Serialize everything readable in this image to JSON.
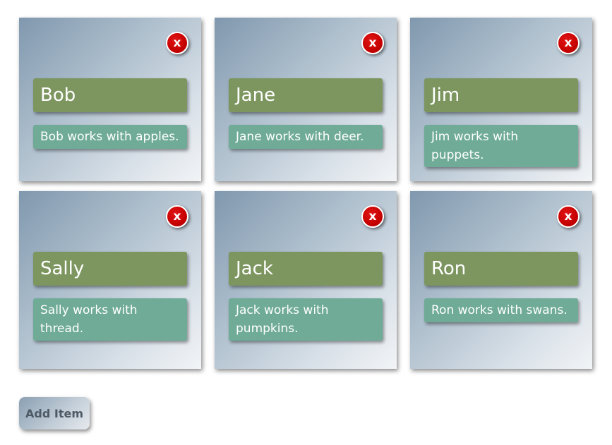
{
  "cards": [
    {
      "name": "Bob",
      "description": "Bob works with apples.",
      "close_label": "x"
    },
    {
      "name": "Jane",
      "description": "Jane works with deer.",
      "close_label": "x"
    },
    {
      "name": "Jim",
      "description": "Jim works with puppets.",
      "close_label": "x"
    },
    {
      "name": "Sally",
      "description": "Sally works with thread.",
      "close_label": "x"
    },
    {
      "name": "Jack",
      "description": "Jack works with pumpkins.",
      "close_label": "x"
    },
    {
      "name": "Ron",
      "description": "Ron works with swans.",
      "close_label": "x"
    }
  ],
  "add_button_label": "Add Item",
  "colors": {
    "name_bar": "#7d9660",
    "description_bar": "#6fab96",
    "close_button": "#c60000"
  }
}
